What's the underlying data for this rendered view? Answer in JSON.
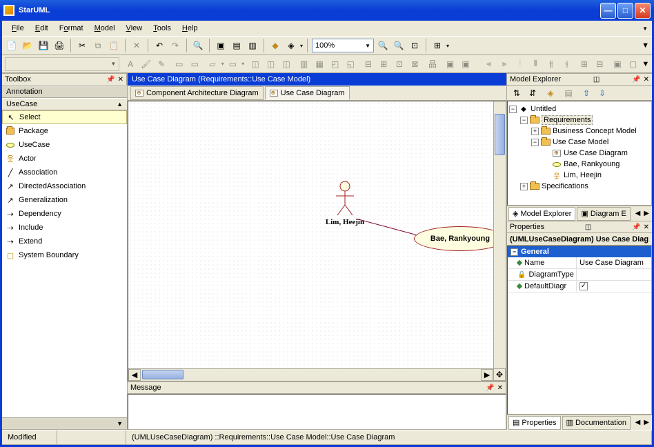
{
  "window": {
    "title": "StarUML"
  },
  "menu": {
    "file": "File",
    "edit": "Edit",
    "format": "Format",
    "model": "Model",
    "view": "View",
    "tools": "Tools",
    "help": "Help"
  },
  "toolbar": {
    "zoom": "100%"
  },
  "toolbox": {
    "title": "Toolbox",
    "cat_annotation": "Annotation",
    "cat_usecase": "UseCase",
    "items": {
      "select": "Select",
      "package": "Package",
      "usecase": "UseCase",
      "actor": "Actor",
      "association": "Association",
      "directed": "DirectedAssociation",
      "generalization": "Generalization",
      "dependency": "Dependency",
      "include": "Include",
      "extend": "Extend",
      "boundary": "System Boundary"
    }
  },
  "diagram": {
    "title": "Use Case Diagram (Requirements::Use Case Model)",
    "tab1": "Component Architecture Diagram",
    "tab2": "Use Case Diagram",
    "actor_label": "Lim, Heejin",
    "usecase_label": "Bae, Rankyoung"
  },
  "explorer": {
    "title": "Model Explorer",
    "root": "Untitled",
    "requirements": "Requirements",
    "bcm": "Business Concept Model",
    "ucm": "Use Case Model",
    "ucd": "Use Case Diagram",
    "bae": "Bae, Rankyoung",
    "lim": "Lim, Heejin",
    "specs": "Specifications",
    "tab_me": "Model Explorer",
    "tab_de": "Diagram E"
  },
  "properties": {
    "title": "Properties",
    "header": "(UMLUseCaseDiagram) Use Case Diag",
    "cat": "General",
    "name_k": "Name",
    "name_v": "Use Case Diagram",
    "type_k": "DiagramType",
    "default_k": "DefaultDiagr",
    "tab_props": "Properties",
    "tab_doc": "Documentation"
  },
  "message": {
    "title": "Message"
  },
  "status": {
    "modified": "Modified",
    "path": "(UMLUseCaseDiagram) ::Requirements::Use Case Model::Use Case Diagram"
  }
}
